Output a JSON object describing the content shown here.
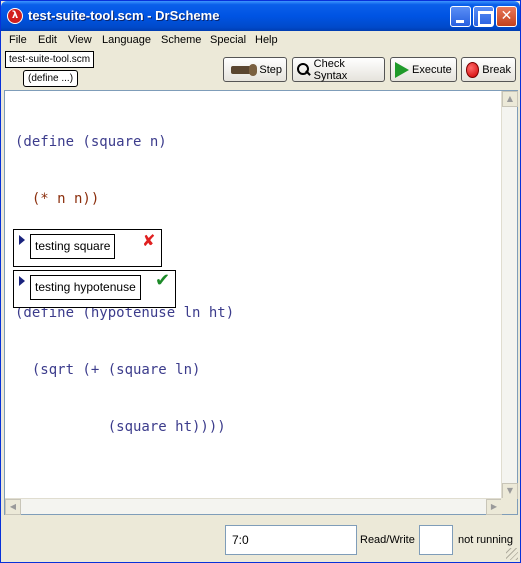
{
  "window": {
    "title": "test-suite-tool.scm - DrScheme",
    "app_icon": "lambda-icon"
  },
  "menu": {
    "items": [
      "File",
      "Edit",
      "View",
      "Language",
      "Scheme",
      "Special",
      "Help"
    ]
  },
  "toolbar": {
    "file_tab": "test-suite-tool.scm",
    "define_menu": "(define ...)",
    "step_label": "Step",
    "check_syntax_label": "Check Syntax",
    "execute_label": "Execute",
    "break_label": "Break"
  },
  "editor": {
    "code_lines": [
      "(define (square n)",
      "  (* n n))",
      "",
      "(define (hypotenuse ln ht)",
      "  (sqrt (+ (square ln)",
      "           (square ht))))"
    ],
    "tests": [
      {
        "label": "testing square",
        "status": "fail",
        "status_icon": "x-icon"
      },
      {
        "label": "testing hypotenuse",
        "status": "pass",
        "status_icon": "checkmark-icon"
      }
    ]
  },
  "statusbar": {
    "position": "7:0",
    "mode": "Read/Write",
    "run_status": "not running"
  },
  "colors": {
    "paren": "#8b2e0c",
    "keyword": "#3c3c8c",
    "fail": "#e02020",
    "pass": "#1c8a28"
  }
}
